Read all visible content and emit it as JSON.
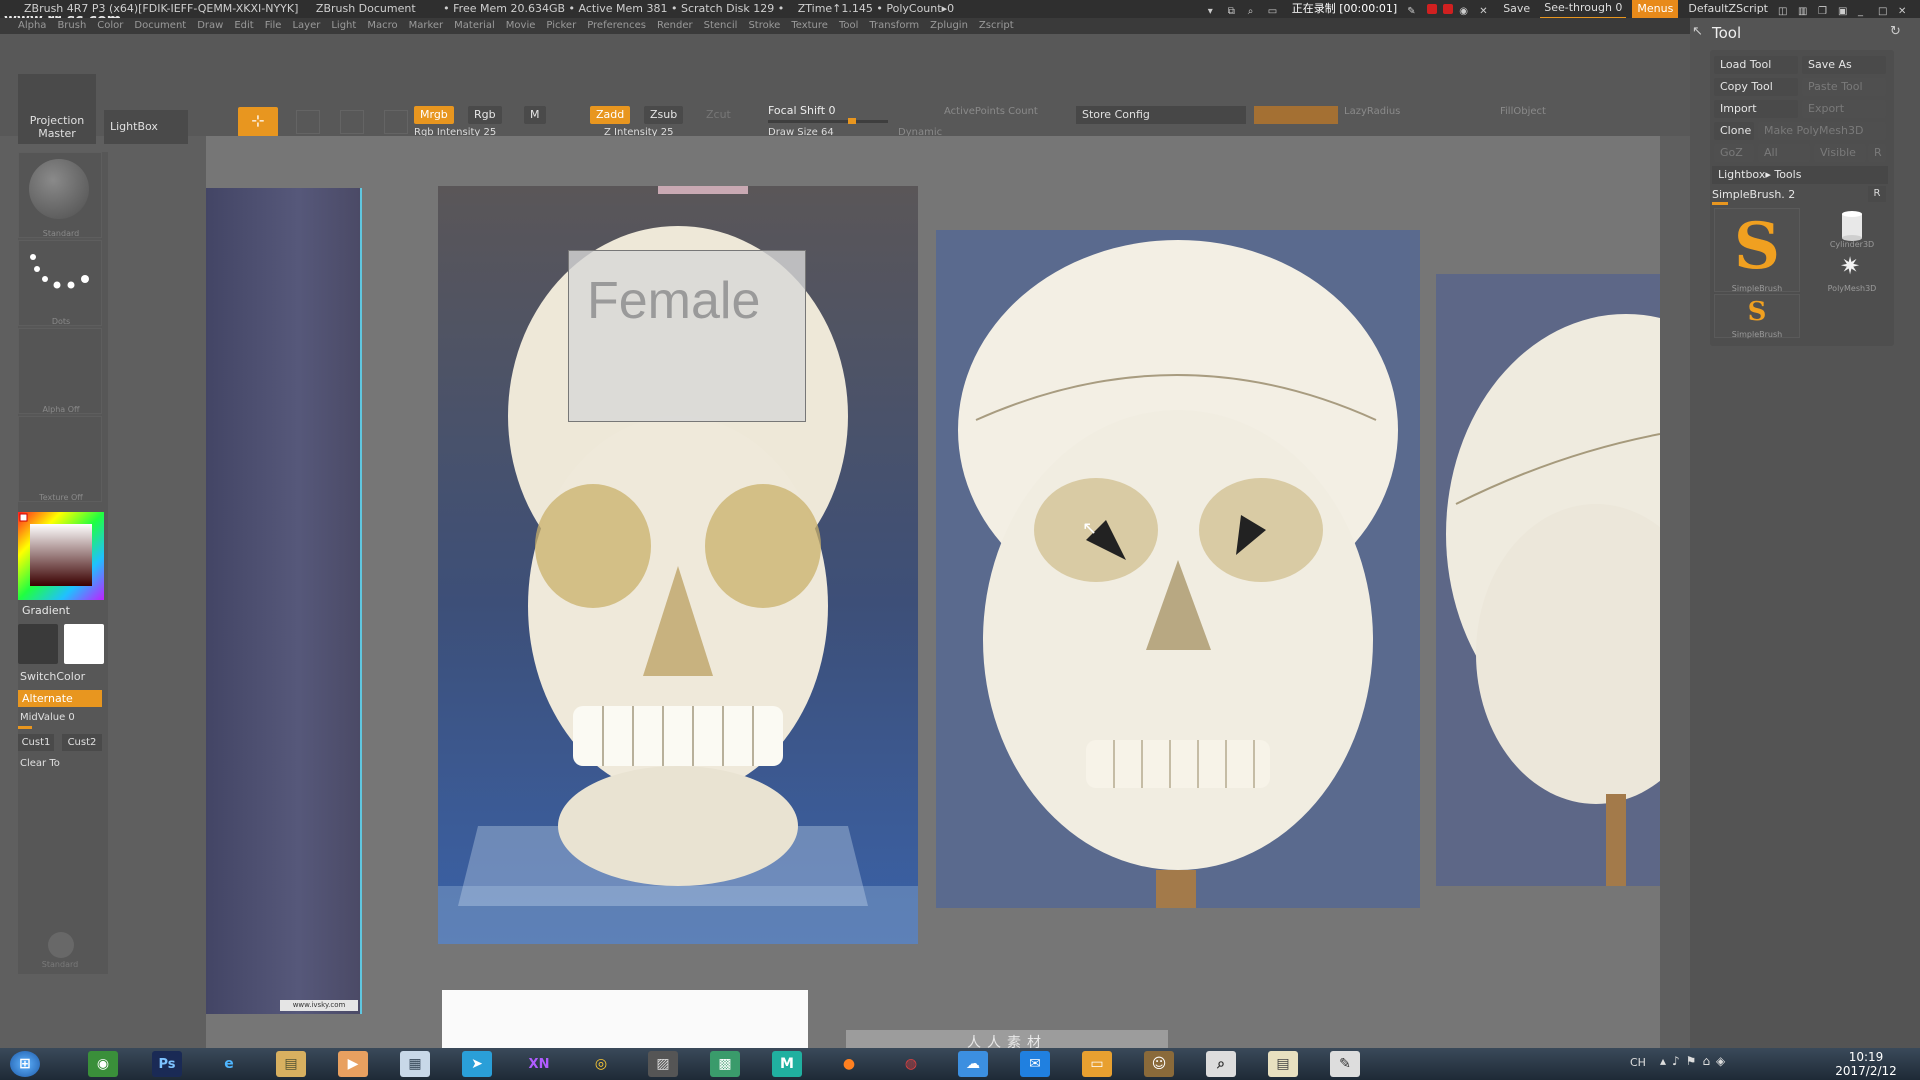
{
  "titlebar": {
    "app": "ZBrush 4R7 P3 (x64)[FDIK-IEFF-QEMM-XKXI-NYYK]",
    "doc": "ZBrush Document",
    "mem": "• Free Mem 20.634GB • Active Mem 381 • Scratch Disk 129 •",
    "ztime": "ZTime↑1.145 • PolyCount▸0",
    "recording": "正在录制 [00:00:01]",
    "save": "Save",
    "see_through": "See-through  0",
    "menus": "Menus",
    "script": "DefaultZScript"
  },
  "watermark_url": "www.rr-sc.com",
  "menubar": [
    "Alpha",
    "Brush",
    "Color",
    "Document",
    "Draw",
    "Edit",
    "File",
    "Layer",
    "Light",
    "Macro",
    "Marker",
    "Material",
    "Movie",
    "Picker",
    "Preferences",
    "Render",
    "Stencil",
    "Stroke",
    "Texture",
    "Tool",
    "Transform",
    "Zplugin",
    "Zscript"
  ],
  "toolbar": {
    "projection_master": "Projection Master",
    "lightbox": "LightBox",
    "mrgb": "Mrgb",
    "rgb": "Rgb",
    "m": "M",
    "rgb_intensity": "Rgb Intensity 25",
    "zadd": "Zadd",
    "zsub": "Zsub",
    "zcut": "Zcut",
    "z_intensity": "Z Intensity 25",
    "focal_shift": "Focal Shift 0",
    "draw_size": "Draw Size 64",
    "dynamic": "Dynamic",
    "active_points": "ActivePoints Count",
    "store_config": "Store Config",
    "lazy_radius": "LazyRadius",
    "fill_object": "FillObject"
  },
  "leftshelf": {
    "slots": [
      "Standard",
      "Dots",
      "Alpha Off",
      "Texture Off"
    ],
    "gradient": "Gradient",
    "switch_color": "SwitchColor",
    "alternate": "Alternate",
    "mid_value": "MidValue 0",
    "cust1": "Cust1",
    "cust2": "Cust2",
    "clear_to": "Clear To",
    "bottom_slot": "Standard"
  },
  "canvas": {
    "female_label": "Female",
    "strip_caption": "www.ivsky.com",
    "banner": "人人素材"
  },
  "toolpanel": {
    "title": "Tool",
    "buttons": [
      {
        "label": "Load Tool",
        "enabled": true
      },
      {
        "label": "Save As",
        "enabled": true
      },
      {
        "label": "Copy Tool",
        "enabled": true
      },
      {
        "label": "Paste Tool",
        "enabled": false
      },
      {
        "label": "Import",
        "enabled": true
      },
      {
        "label": "Export",
        "enabled": false
      },
      {
        "label": "Clone",
        "enabled": true
      },
      {
        "label": "Make PolyMesh3D",
        "enabled": false
      },
      {
        "label": "GoZ",
        "enabled": false
      },
      {
        "label": "All",
        "enabled": false
      },
      {
        "label": "Visible",
        "enabled": false
      },
      {
        "label": "R",
        "enabled": false
      }
    ],
    "lightbox_tools": "Lightbox▸ Tools",
    "current_tool": "SimpleBrush. 2",
    "r": "R",
    "thumbs": [
      {
        "label": "SimpleBrush"
      },
      {
        "label": "Cylinder3D"
      },
      {
        "label": "PolyMesh3D"
      },
      {
        "label": "SimpleBrush"
      }
    ]
  },
  "taskbar": {
    "time": "10:19",
    "date": "2017/2/12",
    "lang": "CH",
    "apps": [
      "Ps",
      "XN"
    ]
  },
  "colors": {
    "accent": "#e8961f",
    "strip_border": "#5fc7e0"
  }
}
